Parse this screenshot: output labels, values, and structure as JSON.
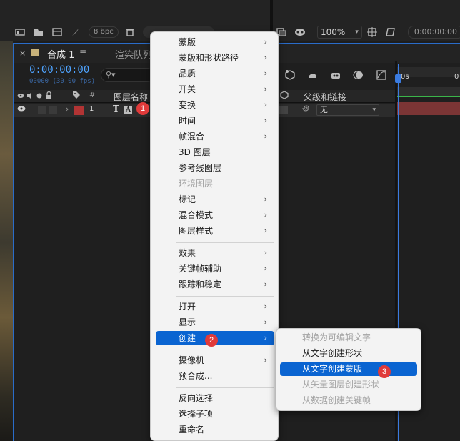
{
  "toolbar_left": {
    "bpc": "8 bpc"
  },
  "toolbar_right": {
    "zoom": "100%",
    "timecode": "0:00:00:00"
  },
  "comp_panel": {
    "tab_close": "×",
    "tab_title": "合成 1",
    "tab_menu": "≡",
    "render_tab": "渲染队列",
    "current_time": "0:00:00:00",
    "frame_info": "00000 (30.00 fps)",
    "search_icon": "⚲▾"
  },
  "layer_header": {
    "hash": "#",
    "name_col": "图层名称",
    "parent_col": "父级和链接"
  },
  "layer_row": {
    "number": "1",
    "type_T": "T",
    "type_A": "A",
    "parent_value": "无"
  },
  "timeline": {
    "ruler_start": "0s",
    "ruler_next": "0"
  },
  "context_menu": {
    "items": [
      {
        "label": "蒙版",
        "submenu": true,
        "disabled": false
      },
      {
        "label": "蒙版和形状路径",
        "submenu": true,
        "disabled": false
      },
      {
        "label": "品质",
        "submenu": true,
        "disabled": false
      },
      {
        "label": "开关",
        "submenu": true,
        "disabled": false
      },
      {
        "label": "变换",
        "submenu": true,
        "disabled": false
      },
      {
        "label": "时间",
        "submenu": true,
        "disabled": false
      },
      {
        "label": "帧混合",
        "submenu": true,
        "disabled": false
      },
      {
        "label": "3D 图层",
        "submenu": false,
        "disabled": false
      },
      {
        "label": "参考线图层",
        "submenu": false,
        "disabled": false
      },
      {
        "label": "环境图层",
        "submenu": false,
        "disabled": true
      },
      {
        "label": "标记",
        "submenu": true,
        "disabled": false
      },
      {
        "label": "混合模式",
        "submenu": true,
        "disabled": false
      },
      {
        "label": "图层样式",
        "submenu": true,
        "disabled": false
      },
      {
        "label": "效果",
        "submenu": true,
        "disabled": false
      },
      {
        "label": "关键帧辅助",
        "submenu": true,
        "disabled": false
      },
      {
        "label": "跟踪和稳定",
        "submenu": true,
        "disabled": false
      },
      {
        "label": "打开",
        "submenu": true,
        "disabled": false
      },
      {
        "label": "显示",
        "submenu": true,
        "disabled": false
      },
      {
        "label": "创建",
        "submenu": true,
        "disabled": false,
        "active": true
      },
      {
        "label": "摄像机",
        "submenu": true,
        "disabled": false
      },
      {
        "label": "预合成...",
        "submenu": false,
        "disabled": false
      },
      {
        "label": "反向选择",
        "submenu": false,
        "disabled": false
      },
      {
        "label": "选择子项",
        "submenu": false,
        "disabled": false
      },
      {
        "label": "重命名",
        "submenu": false,
        "disabled": false
      }
    ]
  },
  "create_submenu": {
    "items": [
      {
        "label": "转换为可编辑文字",
        "disabled": true
      },
      {
        "label": "从文字创建形状",
        "disabled": false
      },
      {
        "label": "从文字创建蒙版",
        "disabled": false,
        "active": true
      },
      {
        "label": "从矢量图层创建形状",
        "disabled": true
      },
      {
        "label": "从数据创建关键帧",
        "disabled": true
      }
    ]
  },
  "badges": {
    "b1": "1",
    "b2": "2",
    "b3": "3"
  },
  "colors": {
    "accent_blue": "#0a64d1",
    "badge_red": "#e03a3a",
    "label_red": "#b23434"
  }
}
